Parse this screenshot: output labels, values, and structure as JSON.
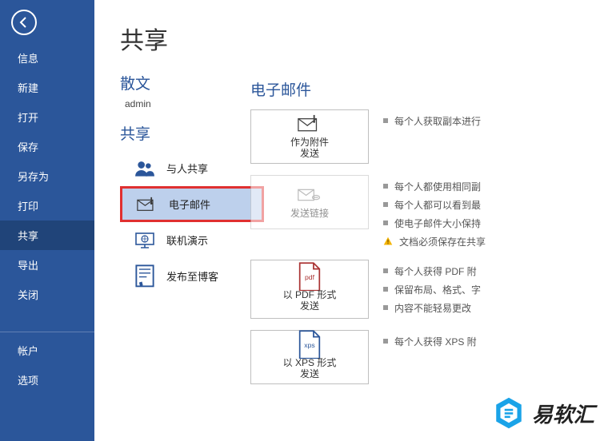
{
  "sidebar": {
    "items": [
      {
        "label": "信息"
      },
      {
        "label": "新建"
      },
      {
        "label": "打开"
      },
      {
        "label": "保存"
      },
      {
        "label": "另存为"
      },
      {
        "label": "打印"
      },
      {
        "label": "共享"
      },
      {
        "label": "导出"
      },
      {
        "label": "关闭"
      }
    ],
    "lower": [
      {
        "label": "帐户"
      },
      {
        "label": "选项"
      }
    ]
  },
  "page": {
    "title": "共享"
  },
  "doc": {
    "heading": "散文",
    "author": "admin"
  },
  "share": {
    "heading": "共享",
    "items": [
      {
        "label": "与人共享"
      },
      {
        "label": "电子邮件"
      },
      {
        "label": "联机演示"
      },
      {
        "label": "发布至博客"
      }
    ]
  },
  "right": {
    "heading": "电子邮件",
    "tiles": {
      "attach": "作为附件\n发送",
      "link": "发送链接",
      "pdf": "以 PDF 形式\n发送",
      "xps": "以 XPS 形式\n发送"
    },
    "bullets": {
      "b1": "每个人获取副本进行",
      "b2": "每个人都使用相同副",
      "b3": "每个人都可以看到最",
      "b4": "使电子邮件大小保持",
      "warn": "文档必须保存在共享",
      "b5": "每个人获得 PDF 附",
      "b6": "保留布局、格式、字",
      "b7": "内容不能轻易更改",
      "b8": "每个人获得 XPS 附"
    }
  },
  "watermark": {
    "text": "易软汇"
  }
}
